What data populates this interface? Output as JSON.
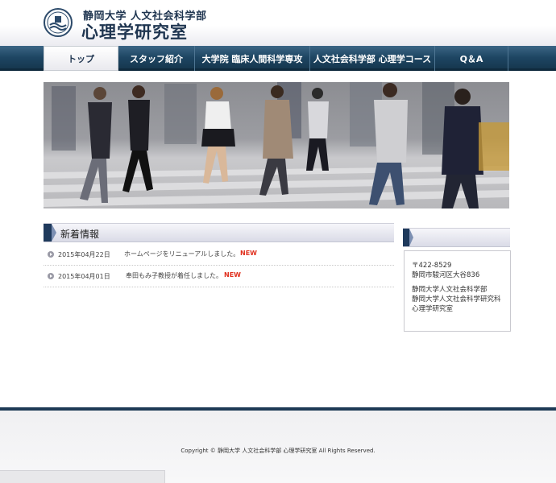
{
  "header": {
    "subtitle": "静岡大学 人文社会科学部",
    "title": "心理学研究室"
  },
  "nav": {
    "items": [
      {
        "label": "トップ",
        "active": true
      },
      {
        "label": "スタッフ紹介",
        "active": false
      },
      {
        "label": "大学院 臨床人間科学専攻",
        "active": false
      },
      {
        "label": "人文社会科学部 心理学コース",
        "active": false
      },
      {
        "label": "Q＆A",
        "active": false
      }
    ]
  },
  "news": {
    "heading": "新着情報",
    "items": [
      {
        "date": "2015年04月22日",
        "text": "ホームページをリニューアルしました。",
        "badge": "NEW"
      },
      {
        "date": "2015年04月01日",
        "text": "奉田もみ子教授が着任しました。",
        "badge": "NEW"
      }
    ]
  },
  "sidebar": {
    "postal": "〒422-8529",
    "address": "静岡市駿河区大谷836",
    "org1": "静岡大学人文社会科学部",
    "org2": "静岡大学人文社会科学研究科",
    "org3": "心理学研究室"
  },
  "footer": {
    "copyright": "Copyright © 静岡大学 人文社会科学部 心理学研究室 All Rights Reserved."
  },
  "colors": {
    "navy": "#1f3550",
    "nav_bg": "#1e4663",
    "new_badge": "#e0301e"
  },
  "icons": {
    "logo": "university-seal-icon",
    "bullet": "arrow-bullet-icon"
  }
}
